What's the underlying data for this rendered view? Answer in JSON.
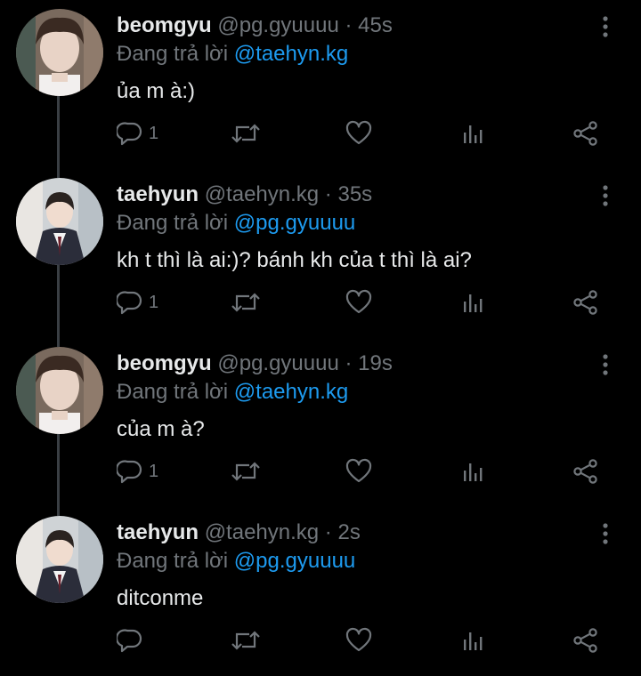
{
  "accent_color": "#1d9bf0",
  "muted_color": "#71767b",
  "tweets": [
    {
      "display_name": "beomgyu",
      "handle": "@pg.gyuuuu",
      "separator": "·",
      "time": "45s",
      "reply_prefix": "Đang trả lời",
      "reply_to": "@taehyn.kg",
      "text": "ủa m à:)",
      "reply_count": "1",
      "avatar": "beomgyu-avatar"
    },
    {
      "display_name": "taehyun",
      "handle": "@taehyn.kg",
      "separator": "·",
      "time": "35s",
      "reply_prefix": "Đang trả lời",
      "reply_to": "@pg.gyuuuu",
      "text": "kh t thì là ai:)? bánh kh của t thì là ai?",
      "reply_count": "1",
      "avatar": "taehyun-avatar"
    },
    {
      "display_name": "beomgyu",
      "handle": "@pg.gyuuuu",
      "separator": "·",
      "time": "19s",
      "reply_prefix": "Đang trả lời",
      "reply_to": "@taehyn.kg",
      "text": "của m à?",
      "reply_count": "1",
      "avatar": "beomgyu-avatar"
    },
    {
      "display_name": "taehyun",
      "handle": "@taehyn.kg",
      "separator": "·",
      "time": "2s",
      "reply_prefix": "Đang trả lời",
      "reply_to": "@pg.gyuuuu",
      "text": "ditconme",
      "reply_count": "",
      "avatar": "taehyun-avatar"
    }
  ],
  "icons": {
    "reply": "reply-icon",
    "retweet": "retweet-icon",
    "like": "heart-icon",
    "views": "views-icon",
    "share": "share-icon",
    "more": "more-vertical-icon"
  }
}
